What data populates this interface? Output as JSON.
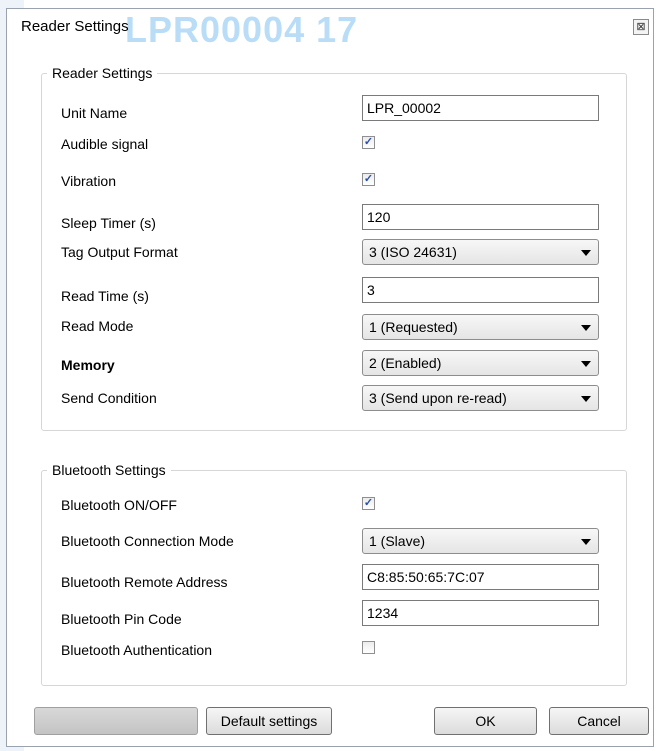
{
  "window": {
    "title": "Reader Settings",
    "ghost_text": "LPR00004 17",
    "close_glyph": "⊠"
  },
  "reader_group": {
    "legend": "Reader Settings",
    "unit_name": {
      "label": "Unit Name",
      "value": "LPR_00002"
    },
    "audible_signal": {
      "label": "Audible signal",
      "checked": true
    },
    "vibration": {
      "label": "Vibration",
      "checked": true
    },
    "sleep_timer": {
      "label": "Sleep Timer (s)",
      "value": "120"
    },
    "tag_output_format": {
      "label": "Tag Output Format",
      "selected": "3 (ISO 24631)"
    },
    "read_time": {
      "label": "Read Time (s)",
      "value": "3"
    },
    "read_mode": {
      "label": "Read Mode",
      "selected": "1 (Requested)"
    },
    "memory": {
      "label": "Memory",
      "selected": "2 (Enabled)"
    },
    "send_condition": {
      "label": "Send Condition",
      "selected": "3 (Send upon re-read)"
    }
  },
  "bluetooth_group": {
    "legend": "Bluetooth Settings",
    "bt_on_off": {
      "label": "Bluetooth ON/OFF",
      "checked": true
    },
    "bt_connection_mode": {
      "label": "Bluetooth Connection Mode",
      "selected": "1 (Slave)"
    },
    "bt_remote_address": {
      "label": "Bluetooth Remote Address",
      "value": "C8:85:50:65:7C:07"
    },
    "bt_pin_code": {
      "label": "Bluetooth Pin Code",
      "value": "1234"
    },
    "bt_authentication": {
      "label": "Bluetooth Authentication",
      "checked": false
    }
  },
  "buttons": {
    "default_settings": "Default settings",
    "ok": "OK",
    "cancel": "Cancel"
  },
  "check_glyph": "✓",
  "colors": {
    "ghost_text": "#b9dcf7",
    "check": "#2b4fa8"
  }
}
